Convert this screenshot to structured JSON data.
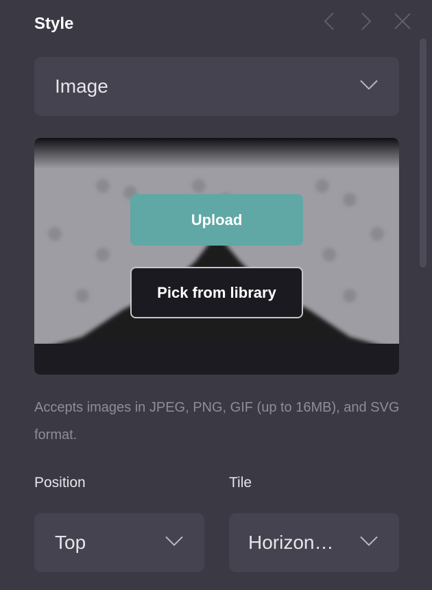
{
  "header": {
    "title": "Style"
  },
  "icons": {
    "prev": "chevron-left-icon",
    "next": "chevron-right-icon",
    "close": "close-icon",
    "dropdown": "chevron-down-icon"
  },
  "background_type": {
    "selected": "Image"
  },
  "image_picker": {
    "upload_label": "Upload",
    "library_label": "Pick from library",
    "help_text": "Accepts images in JPEG, PNG, GIF (up to 16MB), and SVG format."
  },
  "position": {
    "label": "Position",
    "selected": "Top"
  },
  "tile": {
    "label": "Tile",
    "selected": "Horizon…"
  },
  "colors": {
    "panel_bg": "#3a3944",
    "field_bg": "#44434f",
    "accent": "#5fa8a6",
    "muted_text": "#8e8d99"
  }
}
